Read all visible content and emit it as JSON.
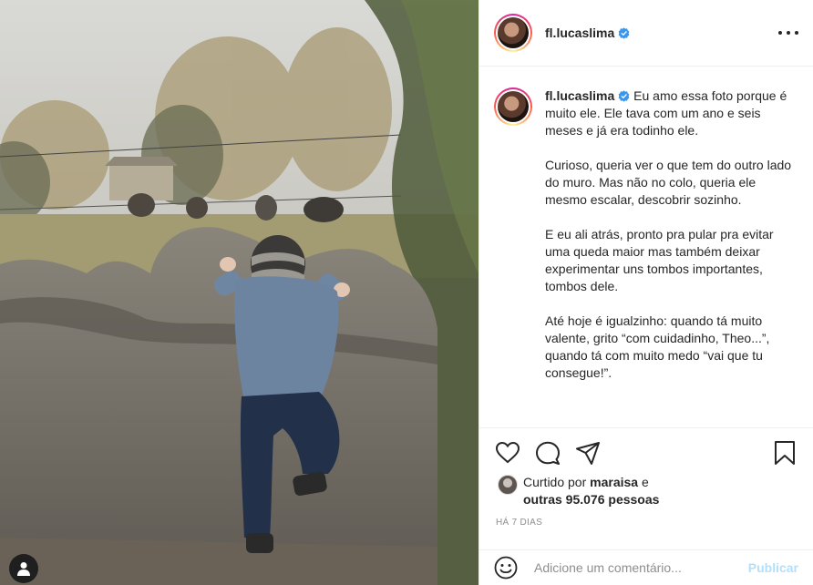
{
  "post": {
    "username": "fl.lucaslima",
    "verified": true,
    "caption_paragraphs": [
      "Eu amo essa foto porque é muito ele. Ele tava com um ano e seis meses e já era todinho ele.",
      "Curioso, queria ver o que tem do outro lado do muro. Mas não no colo, queria ele mesmo escalar, descobrir sozinho.",
      "E eu ali atrás, pronto pra pular pra evitar uma queda maior mas também deixar experimentar uns tombos importantes, tombos dele.",
      "Até hoje é igualzinho: quando tá muito valente, grito “com cuidadinho, Theo...”, quando tá com muito medo “vai que tu consegue!”."
    ],
    "likes": {
      "prefix": "Curtido por",
      "user": "maraisa",
      "connector": "e",
      "others": "outras 95.076 pessoas"
    },
    "time_ago": "HÁ 7 DIAS"
  },
  "comment": {
    "placeholder": "Adicione um comentário...",
    "publish_label": "Publicar"
  },
  "icons": {
    "more": "more-options-icon",
    "like": "heart-icon",
    "comment": "comment-bubble-icon",
    "share": "paper-plane-icon",
    "save": "bookmark-icon",
    "emoji": "emoji-smile-icon",
    "tag": "user-tag-icon",
    "verified": "verified-badge-icon"
  },
  "colors": {
    "verified": "#3897f0",
    "publish_disabled": "#b2dffc",
    "muted_text": "#8e8e8e",
    "border": "#efefef"
  }
}
